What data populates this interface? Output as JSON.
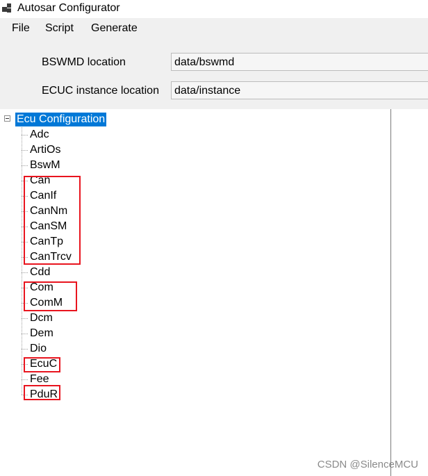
{
  "window": {
    "title": "Autosar Configurator"
  },
  "menu": [
    "File",
    "Script",
    "Generate"
  ],
  "settings": {
    "bswmd_label": "BSWMD location",
    "bswmd_value": "data/bswmd",
    "ecuc_label": "ECUC instance location",
    "ecuc_value": "data/instance"
  },
  "tree": {
    "root": "Ecu Configuration",
    "items": [
      "Adc",
      "ArtiOs",
      "BswM",
      "Can",
      "CanIf",
      "CanNm",
      "CanSM",
      "CanTp",
      "CanTrcv",
      "Cdd",
      "Com",
      "ComM",
      "Dcm",
      "Dem",
      "Dio",
      "EcuC",
      "Fee",
      "PduR"
    ],
    "highlight_color": "#e8141e",
    "selected_color": "#0078d7"
  },
  "watermark": "CSDN @SilenceMCU"
}
